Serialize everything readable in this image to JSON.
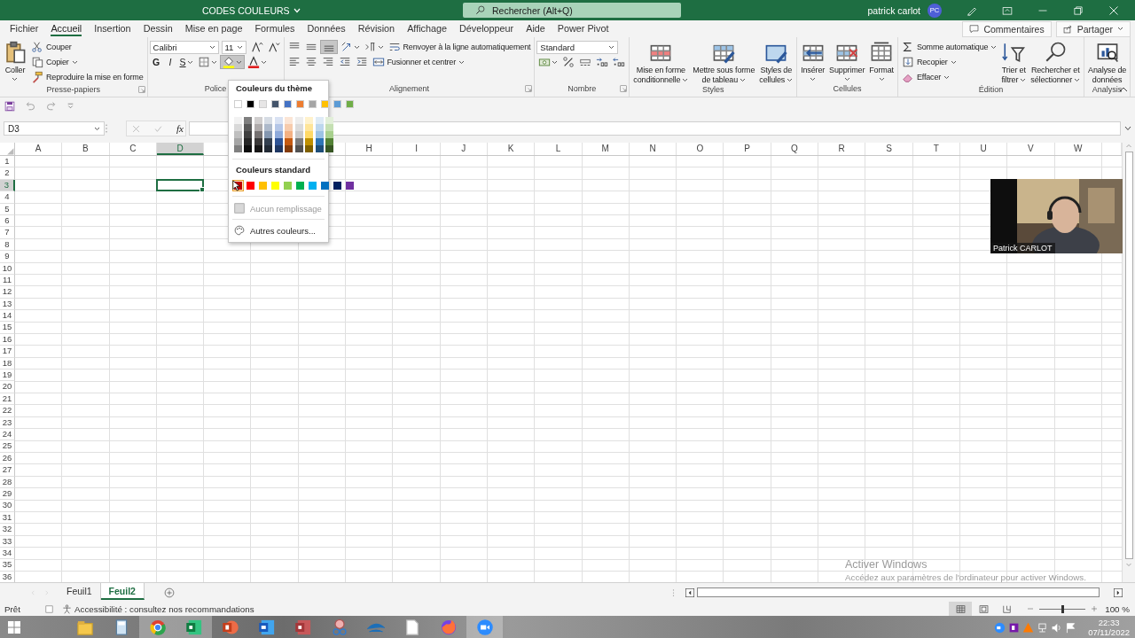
{
  "title_bar": {
    "document_title": "CODES COULEURS",
    "search_placeholder": "Rechercher (Alt+Q)",
    "user_name": "patrick carlot",
    "user_initials": "PC"
  },
  "ribbon_tabs": [
    {
      "label": "Fichier",
      "selected": false
    },
    {
      "label": "Accueil",
      "selected": true
    },
    {
      "label": "Insertion",
      "selected": false
    },
    {
      "label": "Dessin",
      "selected": false
    },
    {
      "label": "Mise en page",
      "selected": false
    },
    {
      "label": "Formules",
      "selected": false
    },
    {
      "label": "Données",
      "selected": false
    },
    {
      "label": "Révision",
      "selected": false
    },
    {
      "label": "Affichage",
      "selected": false
    },
    {
      "label": "Développeur",
      "selected": false
    },
    {
      "label": "Aide",
      "selected": false
    },
    {
      "label": "Power Pivot",
      "selected": false
    }
  ],
  "ribbon_actions": [
    "Commentaires",
    "Partager"
  ],
  "ribbon_groups": [
    {
      "label": "Presse-papiers",
      "launcher": true,
      "blocks": [
        {
          "kind": "large",
          "label": "Coller",
          "menu": true
        },
        {
          "kind": "rows",
          "rows": [
            {
              "items": [
                {
                  "kind": "button",
                  "label": "Couper",
                  "menu": false
                }
              ]
            },
            {
              "items": [
                {
                  "kind": "button",
                  "label": "Copier",
                  "menu": true
                }
              ]
            },
            {
              "items": [
                {
                  "kind": "button",
                  "label": "Reproduire la mise en forme",
                  "menu": false
                }
              ]
            }
          ]
        }
      ]
    },
    {
      "label": "Police",
      "launcher": false,
      "blocks": [
        {
          "kind": "rows",
          "rows": [
            {
              "items": [
                {
                  "kind": "combo",
                  "value": "Calibri"
                },
                {
                  "kind": "combo",
                  "value": "11"
                },
                {
                  "kind": "icon",
                  "menu": false,
                  "pressed": false
                },
                {
                  "kind": "icon",
                  "menu": false,
                  "pressed": false
                }
              ]
            },
            {
              "items": [
                {
                  "kind": "glyph",
                  "label": "G",
                  "menu": false
                },
                {
                  "kind": "glyph",
                  "label": "I",
                  "menu": false
                },
                {
                  "kind": "glyph",
                  "label": "S",
                  "menu": true
                },
                {
                  "kind": "icon",
                  "menu": true,
                  "pressed": false
                },
                {
                  "kind": "icon",
                  "menu": true,
                  "pressed": true
                },
                {
                  "kind": "icon",
                  "menu": true,
                  "pressed": false
                }
              ]
            }
          ]
        }
      ]
    },
    {
      "label": "Alignement",
      "launcher": true,
      "blocks": [
        {
          "kind": "rows",
          "rows": [
            {
              "items": [
                {
                  "kind": "icon",
                  "menu": false,
                  "pressed": false
                },
                {
                  "kind": "icon",
                  "menu": false,
                  "pressed": false
                },
                {
                  "kind": "icon",
                  "menu": false,
                  "pressed": true
                },
                {
                  "kind": "icon",
                  "menu": true,
                  "pressed": false
                },
                {
                  "kind": "icon",
                  "menu": true,
                  "pressed": false
                },
                {
                  "kind": "button",
                  "label": "Renvoyer à la ligne automatiquement",
                  "menu": false
                }
              ]
            },
            {
              "items": [
                {
                  "kind": "icon",
                  "menu": false,
                  "pressed": false
                },
                {
                  "kind": "icon",
                  "menu": false,
                  "pressed": false
                },
                {
                  "kind": "icon",
                  "menu": false,
                  "pressed": false
                },
                {
                  "kind": "icon",
                  "menu": false,
                  "pressed": false
                },
                {
                  "kind": "icon",
                  "menu": false,
                  "pressed": false
                },
                {
                  "kind": "button",
                  "label": "Fusionner et centrer",
                  "menu": true
                }
              ]
            }
          ]
        }
      ]
    },
    {
      "label": "Nombre",
      "launcher": true,
      "blocks": [
        {
          "kind": "rows",
          "rows": [
            {
              "items": [
                {
                  "kind": "combo",
                  "value": "Standard"
                }
              ]
            },
            {
              "items": [
                {
                  "kind": "icon",
                  "menu": true,
                  "pressed": false
                },
                {
                  "kind": "icon",
                  "menu": false,
                  "pressed": false
                },
                {
                  "kind": "icon",
                  "menu": false,
                  "pressed": false
                },
                {
                  "kind": "icon",
                  "menu": false,
                  "pressed": false
                },
                {
                  "kind": "icon",
                  "menu": false,
                  "pressed": false
                }
              ]
            }
          ]
        }
      ]
    },
    {
      "label": "Styles",
      "launcher": false,
      "blocks": [
        {
          "kind": "large",
          "label": "Mise en forme\nconditionnelle",
          "menu": true
        },
        {
          "kind": "large",
          "label": "Mettre sous forme\nde tableau",
          "menu": true
        },
        {
          "kind": "large",
          "label": "Styles de\ncellules",
          "menu": true
        }
      ]
    },
    {
      "label": "Cellules",
      "launcher": false,
      "blocks": [
        {
          "kind": "large",
          "label": "Insérer",
          "menu": true
        },
        {
          "kind": "large",
          "label": "Supprimer",
          "menu": true
        },
        {
          "kind": "large",
          "label": "Format",
          "menu": true
        }
      ]
    },
    {
      "label": "Édition",
      "launcher": false,
      "blocks": [
        {
          "kind": "rows",
          "rows": [
            {
              "items": [
                {
                  "kind": "button",
                  "label": "Somme automatique",
                  "menu": true
                }
              ]
            },
            {
              "items": [
                {
                  "kind": "button",
                  "label": "Recopier",
                  "menu": true
                }
              ]
            },
            {
              "items": [
                {
                  "kind": "button",
                  "label": "Effacer",
                  "menu": true
                }
              ]
            }
          ]
        },
        {
          "kind": "large",
          "label": "Trier et\nfiltrer",
          "menu": true
        },
        {
          "kind": "large",
          "label": "Rechercher et\nsélectionner",
          "menu": true
        }
      ]
    },
    {
      "label": "Analysis",
      "launcher": false,
      "blocks": [
        {
          "kind": "large",
          "label": "Analyse de\ndonnées",
          "menu": false
        }
      ]
    }
  ],
  "formula_bar": {
    "name_box": "D3",
    "function_label": "fx"
  },
  "grid": {
    "columns_left": [
      {
        "label": "A",
        "selected": false
      },
      {
        "label": "B",
        "selected": false
      },
      {
        "label": "C",
        "selected": false
      },
      {
        "label": "D",
        "selected": true
      }
    ],
    "columns_right": [
      {
        "label": "H",
        "selected": false
      },
      {
        "label": "I",
        "selected": false
      },
      {
        "label": "J",
        "selected": false
      },
      {
        "label": "K",
        "selected": false
      },
      {
        "label": "L",
        "selected": false
      },
      {
        "label": "M",
        "selected": false
      },
      {
        "label": "N",
        "selected": false
      },
      {
        "label": "O",
        "selected": false
      },
      {
        "label": "P",
        "selected": false
      },
      {
        "label": "Q",
        "selected": false
      },
      {
        "label": "R",
        "selected": false
      },
      {
        "label": "S",
        "selected": false
      },
      {
        "label": "T",
        "selected": false
      },
      {
        "label": "U",
        "selected": false
      },
      {
        "label": "V",
        "selected": false
      },
      {
        "label": "W",
        "selected": false
      }
    ],
    "rows": [
      {
        "label": "1",
        "selected": false
      },
      {
        "label": "2",
        "selected": false
      },
      {
        "label": "3",
        "selected": true
      },
      {
        "label": "4",
        "selected": false
      },
      {
        "label": "5",
        "selected": false
      },
      {
        "label": "6",
        "selected": false
      },
      {
        "label": "7",
        "selected": false
      },
      {
        "label": "8",
        "selected": false
      },
      {
        "label": "9",
        "selected": false
      },
      {
        "label": "10",
        "selected": false
      },
      {
        "label": "11",
        "selected": false
      },
      {
        "label": "12",
        "selected": false
      },
      {
        "label": "13",
        "selected": false
      },
      {
        "label": "14",
        "selected": false
      },
      {
        "label": "15",
        "selected": false
      },
      {
        "label": "16",
        "selected": false
      },
      {
        "label": "17",
        "selected": false
      },
      {
        "label": "18",
        "selected": false
      },
      {
        "label": "19",
        "selected": false
      },
      {
        "label": "20",
        "selected": false
      },
      {
        "label": "21",
        "selected": false
      },
      {
        "label": "22",
        "selected": false
      },
      {
        "label": "23",
        "selected": false
      },
      {
        "label": "24",
        "selected": false
      },
      {
        "label": "25",
        "selected": false
      },
      {
        "label": "26",
        "selected": false
      },
      {
        "label": "27",
        "selected": false
      },
      {
        "label": "28",
        "selected": false
      },
      {
        "label": "29",
        "selected": false
      },
      {
        "label": "30",
        "selected": false
      },
      {
        "label": "31",
        "selected": false
      },
      {
        "label": "32",
        "selected": false
      },
      {
        "label": "33",
        "selected": false
      },
      {
        "label": "34",
        "selected": false
      },
      {
        "label": "35",
        "selected": false
      },
      {
        "label": "36",
        "selected": false
      }
    ]
  },
  "fill_color_menu": {
    "theme_heading": "Couleurs du thème",
    "theme_colors": [
      {
        "color": "#ffffff",
        "shades": [
          {
            "color": "#f2f2f2"
          },
          {
            "color": "#d9d9d9"
          },
          {
            "color": "#bfbfbf"
          },
          {
            "color": "#a6a6a6"
          },
          {
            "color": "#808080"
          }
        ]
      },
      {
        "color": "#000000",
        "shades": [
          {
            "color": "#7f7f7f"
          },
          {
            "color": "#595959"
          },
          {
            "color": "#404040"
          },
          {
            "color": "#262626"
          },
          {
            "color": "#0d0d0d"
          }
        ]
      },
      {
        "color": "#e7e6e6",
        "shades": [
          {
            "color": "#d0cece"
          },
          {
            "color": "#aeaaaa"
          },
          {
            "color": "#757171"
          },
          {
            "color": "#3a3838"
          },
          {
            "color": "#171616"
          }
        ]
      },
      {
        "color": "#44546a",
        "shades": [
          {
            "color": "#d6dce4"
          },
          {
            "color": "#adb9ca"
          },
          {
            "color": "#8497b0"
          },
          {
            "color": "#333f4f"
          },
          {
            "color": "#222a35"
          }
        ]
      },
      {
        "color": "#4472c4",
        "shades": [
          {
            "color": "#d9e2f3"
          },
          {
            "color": "#b4c6e7"
          },
          {
            "color": "#8eaadb"
          },
          {
            "color": "#2f5496"
          },
          {
            "color": "#1f3864"
          }
        ]
      },
      {
        "color": "#ed7d31",
        "shades": [
          {
            "color": "#fbe5d5"
          },
          {
            "color": "#f7cbac"
          },
          {
            "color": "#f4b183"
          },
          {
            "color": "#c55a11"
          },
          {
            "color": "#843c0b"
          }
        ]
      },
      {
        "color": "#a5a5a5",
        "shades": [
          {
            "color": "#ededed"
          },
          {
            "color": "#dbdbdb"
          },
          {
            "color": "#c9c9c9"
          },
          {
            "color": "#7b7b7b"
          },
          {
            "color": "#525252"
          }
        ]
      },
      {
        "color": "#ffc000",
        "shades": [
          {
            "color": "#fff2cc"
          },
          {
            "color": "#ffe599"
          },
          {
            "color": "#ffd966"
          },
          {
            "color": "#bf9000"
          },
          {
            "color": "#7f6000"
          }
        ]
      },
      {
        "color": "#5b9bd5",
        "shades": [
          {
            "color": "#deebf6"
          },
          {
            "color": "#bdd7ee"
          },
          {
            "color": "#9cc3e5"
          },
          {
            "color": "#2e75b5"
          },
          {
            "color": "#1e4e79"
          }
        ]
      },
      {
        "color": "#70ad47",
        "shades": [
          {
            "color": "#e2efd9"
          },
          {
            "color": "#c5e0b3"
          },
          {
            "color": "#a8d08d"
          },
          {
            "color": "#538135"
          },
          {
            "color": "#375623"
          }
        ]
      }
    ],
    "standard_heading": "Couleurs standard",
    "standard_colors": [
      {
        "color": "#c00000",
        "selected": true
      },
      {
        "color": "#ff0000",
        "selected": false
      },
      {
        "color": "#ffc000",
        "selected": false
      },
      {
        "color": "#ffff00",
        "selected": false
      },
      {
        "color": "#92d050",
        "selected": false
      },
      {
        "color": "#00b050",
        "selected": false
      },
      {
        "color": "#00b0f0",
        "selected": false
      },
      {
        "color": "#0070c0",
        "selected": false
      },
      {
        "color": "#002060",
        "selected": false
      },
      {
        "color": "#7030a0",
        "selected": false
      }
    ],
    "no_fill": {
      "label": "Aucun remplissage",
      "disabled": true
    },
    "more_colors": "Autres couleurs..."
  },
  "video_overlay": {
    "participant_name": "Patrick CARLOT"
  },
  "activation_notice": {
    "title": "Activer Windows",
    "message": "Accédez aux paramètres de l'ordinateur pour activer Windows."
  },
  "sheet_tabs": [
    {
      "label": "Feuil1",
      "selected": false
    },
    {
      "label": "Feuil2",
      "selected": true
    }
  ],
  "status_bar": {
    "ready": "Prêt",
    "accessibility": "Accessibilité : consultez nos recommandations",
    "view_buttons": [
      {
        "selected": true
      },
      {
        "selected": false
      },
      {
        "selected": false
      }
    ],
    "zoom_level": {
      "level": 0.5
    },
    "zoom": "100 %"
  },
  "taskbar": {
    "apps": [
      {
        "running": false
      },
      {
        "running": false
      },
      {
        "running": true
      },
      {
        "running": true
      },
      {
        "running": false
      },
      {
        "running": false
      },
      {
        "running": false
      },
      {
        "running": false
      },
      {
        "running": false
      },
      {
        "running": false
      },
      {
        "running": false
      },
      {
        "running": true
      }
    ],
    "clock_time": "22:33",
    "clock_date": "07/11/2022"
  }
}
